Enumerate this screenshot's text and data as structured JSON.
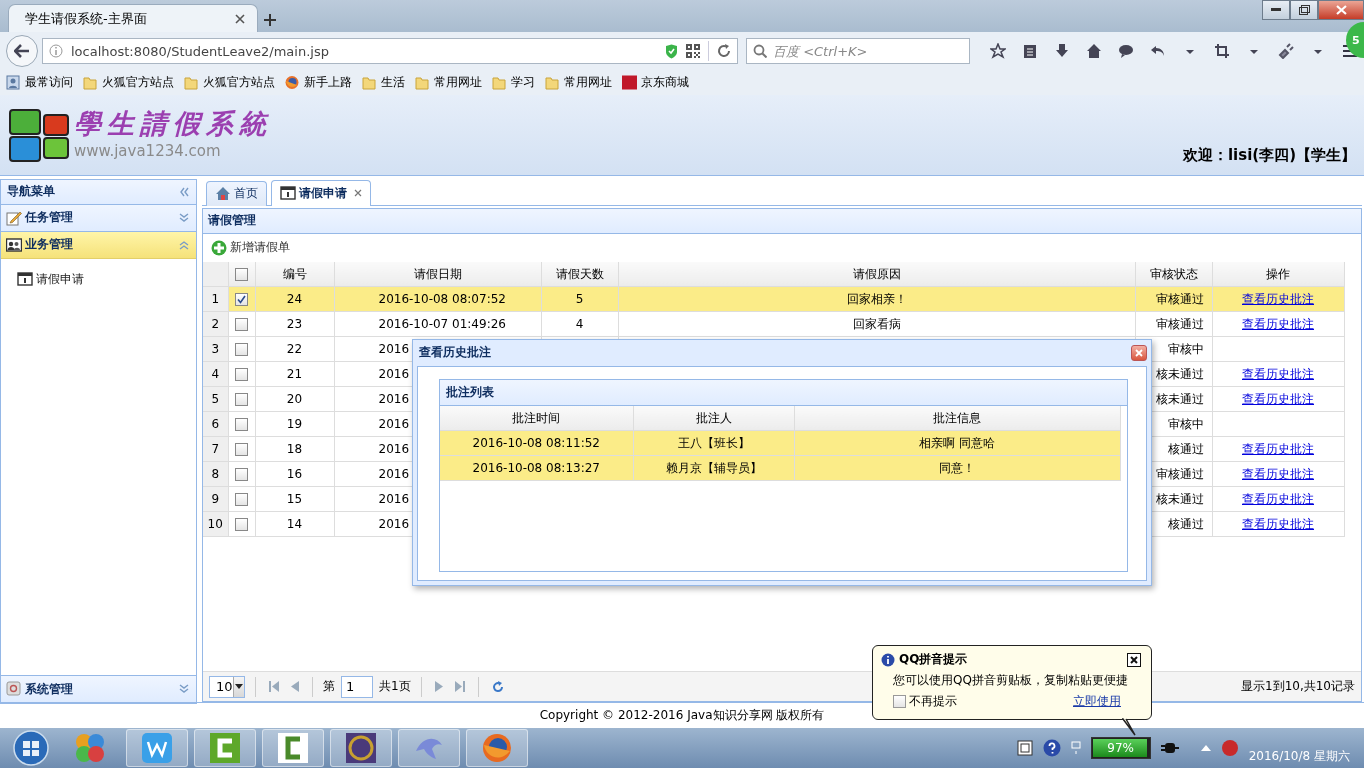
{
  "browser": {
    "tab_title": "学生请假系统-主界面",
    "url": "localhost:8080/StudentLeave2/main.jsp",
    "search_placeholder": "百度 <Ctrl+K>",
    "badge": "5",
    "bookmarks": [
      {
        "label": "最常访问",
        "kind": "recent"
      },
      {
        "label": "火狐官方站点",
        "kind": "folder"
      },
      {
        "label": "火狐官方站点",
        "kind": "folder"
      },
      {
        "label": "新手上路",
        "kind": "firefox"
      },
      {
        "label": "生活",
        "kind": "folder"
      },
      {
        "label": "常用网址",
        "kind": "folder"
      },
      {
        "label": "学习",
        "kind": "folder"
      },
      {
        "label": "常用网址",
        "kind": "folder"
      },
      {
        "label": "京东商城",
        "kind": "jd"
      }
    ]
  },
  "header": {
    "logo_title": "學生請假系統",
    "logo_url": "www.java1234.com",
    "welcome": "欢迎：lisi(李四)【学生】"
  },
  "sidebar": {
    "title": "导航菜单",
    "panels": [
      {
        "title": "任务管理",
        "expanded": false
      },
      {
        "title": "业务管理",
        "expanded": true,
        "items": [
          "请假申请"
        ]
      },
      {
        "title": "系统管理",
        "expanded": false
      }
    ]
  },
  "tabs": [
    {
      "label": "首页",
      "selected": false,
      "kind": "home",
      "closable": false
    },
    {
      "label": "请假申请",
      "selected": true,
      "kind": "calendar",
      "closable": true
    }
  ],
  "grid": {
    "title": "请假管理",
    "add_button": "新增请假单",
    "header_checked": false,
    "columns": [
      "编号",
      "请假日期",
      "请假天数",
      "请假原因",
      "审核状态",
      "操作"
    ],
    "rows": [
      {
        "number": "1",
        "checked": true,
        "selected": true,
        "cells": [
          "24",
          "2016-10-08 08:07:52",
          "5",
          "回家相亲！",
          "审核通过"
        ],
        "link": "查看历史批注"
      },
      {
        "number": "2",
        "checked": false,
        "selected": false,
        "cells": [
          "23",
          "2016-10-07 01:49:26",
          "4",
          "回家看病",
          "审核通过"
        ],
        "link": "查看历史批注"
      },
      {
        "number": "3",
        "checked": false,
        "selected": false,
        "cells": [
          "22",
          "2016",
          "",
          "",
          "审核中"
        ]
      },
      {
        "number": "4",
        "checked": false,
        "selected": false,
        "cells": [
          "21",
          "2016",
          "",
          "",
          "核未通过"
        ],
        "link": "查看历史批注"
      },
      {
        "number": "5",
        "checked": false,
        "selected": false,
        "cells": [
          "20",
          "2016",
          "",
          "",
          "核未通过"
        ],
        "link": "查看历史批注"
      },
      {
        "number": "6",
        "checked": false,
        "selected": false,
        "cells": [
          "19",
          "2016",
          "",
          "",
          "审核中"
        ]
      },
      {
        "number": "7",
        "checked": false,
        "selected": false,
        "cells": [
          "18",
          "2016",
          "",
          "",
          "核通过"
        ],
        "link": "查看历史批注"
      },
      {
        "number": "8",
        "checked": false,
        "selected": false,
        "cells": [
          "16",
          "2016",
          "",
          "",
          "审核通过"
        ],
        "link": "查看历史批注"
      },
      {
        "number": "9",
        "checked": false,
        "selected": false,
        "cells": [
          "15",
          "2016",
          "",
          "",
          "核未通过"
        ],
        "link": "查看历史批注"
      },
      {
        "number": "10",
        "checked": false,
        "selected": false,
        "cells": [
          "14",
          "2016",
          "",
          "",
          "核通过"
        ],
        "link": "查看历史批注"
      }
    ]
  },
  "pager": {
    "page_size": "10",
    "page_prefix": "第",
    "page": "1",
    "total_pages": "共1页",
    "summary": "显示1到10,共10记录"
  },
  "dialog": {
    "title": "查看历史批注",
    "panel_title": "批注列表",
    "columns": [
      "批注时间",
      "批注人",
      "批注信息"
    ],
    "rows": [
      {
        "selected": true,
        "cells": [
          "2016-10-08 08:11:52",
          "王八【班长】",
          "相亲啊 同意哈"
        ]
      },
      {
        "selected": true,
        "cells": [
          "2016-10-08 08:13:27",
          "赖月京【辅导员】",
          "同意！"
        ]
      }
    ]
  },
  "footer": {
    "copyright": "Copyright © 2012-2016 Java知识分享网 版权所有"
  },
  "qq_tip": {
    "title": "QQ拼音提示",
    "message": "您可以使用QQ拼音剪贴板，复制粘贴更便捷",
    "checkbox_label": "不再提示",
    "checked": false,
    "link": "立即使用"
  },
  "taskbar": {
    "battery": {
      "reading": "97%",
      "level": 0.97
    },
    "date": "2016/10/8 星期六"
  }
}
